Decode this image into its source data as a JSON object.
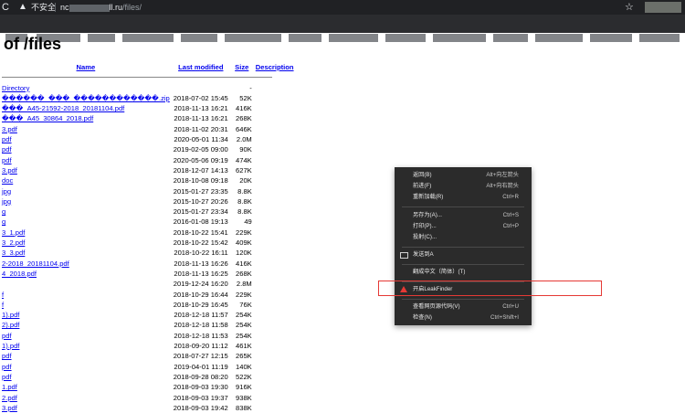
{
  "browser": {
    "reload_glyph": "C",
    "warning_glyph": "▲",
    "insecure_label": "不安全",
    "url_prefix": "nc",
    "url_suffix": "ll.ru",
    "url_path": "/files/",
    "star_glyph": "☆"
  },
  "page": {
    "title": "of /files",
    "columns": [
      "Name",
      "Last modified",
      "Size",
      "Description"
    ],
    "parent_label": "Directory",
    "parent_size": "-",
    "rows": [
      {
        "name": "������_���_������������.zip",
        "modified": "2018-07-02 15:45",
        "size": "52K"
      },
      {
        "name": "���_A45-21592-2018_20181104.pdf",
        "modified": "2018-11-13 16:21",
        "size": "416K"
      },
      {
        "name": "���_A45_30864_2018.pdf",
        "modified": "2018-11-13 16:21",
        "size": "268K"
      },
      {
        "name": "3.pdf",
        "modified": "2018-11-02 20:31",
        "size": "646K"
      },
      {
        "name": "pdf",
        "modified": "2020-05-01 11:34",
        "size": "2.0M"
      },
      {
        "name": "pdf",
        "modified": "2019-02-05 09:00",
        "size": "90K"
      },
      {
        "name": "pdf",
        "modified": "2020-05-06 09:19",
        "size": "474K"
      },
      {
        "name": "3.pdf",
        "modified": "2018-12-07 14:13",
        "size": "627K"
      },
      {
        "name": "doc",
        "modified": "2018-10-08 09:18",
        "size": "20K"
      },
      {
        "name": "jpg",
        "modified": "2015-01-27 23:35",
        "size": "8.8K"
      },
      {
        "name": "jpg",
        "modified": "2015-10-27 20:26",
        "size": "8.8K"
      },
      {
        "name": "g",
        "modified": "2015-01-27 23:34",
        "size": "8.8K"
      },
      {
        "name": "g",
        "modified": "2016-01-08 19:13",
        "size": "49"
      },
      {
        "name": "3_1.pdf",
        "modified": "2018-10-22 15:41",
        "size": "229K"
      },
      {
        "name": "3_2.pdf",
        "modified": "2018-10-22 15:42",
        "size": "409K"
      },
      {
        "name": "3_3.pdf",
        "modified": "2018-10-22 16:11",
        "size": "120K"
      },
      {
        "name": "2-2018_20181104.pdf",
        "modified": "2018-11-13 16:26",
        "size": "416K"
      },
      {
        "name": "4_2018.pdf",
        "modified": "2018-11-13 16:25",
        "size": "268K"
      },
      {
        "name": "",
        "modified": "2019-12-24 16:20",
        "size": "2.8M"
      },
      {
        "name": "f",
        "modified": "2018-10-29 16:44",
        "size": "229K"
      },
      {
        "name": "f",
        "modified": "2018-10-29 16:45",
        "size": "76K"
      },
      {
        "name": "1).pdf",
        "modified": "2018-12-18 11:57",
        "size": "254K"
      },
      {
        "name": "2).pdf",
        "modified": "2018-12-18 11:58",
        "size": "254K"
      },
      {
        "name": "pdf",
        "modified": "2018-12-18 11:53",
        "size": "254K"
      },
      {
        "name": "1).pdf",
        "modified": "2018-09-20 11:12",
        "size": "461K"
      },
      {
        "name": "pdf",
        "modified": "2018-07-27 12:15",
        "size": "265K"
      },
      {
        "name": "pdf",
        "modified": "2019-04-01 11:19",
        "size": "140K"
      },
      {
        "name": "pdf",
        "modified": "2018-09-28 08:20",
        "size": "522K"
      },
      {
        "name": "1.pdf",
        "modified": "2018-09-03 19:30",
        "size": "916K"
      },
      {
        "name": "2.pdf",
        "modified": "2018-09-03 19:37",
        "size": "938K"
      },
      {
        "name": "3.pdf",
        "modified": "2018-09-03 19:42",
        "size": "838K"
      }
    ]
  },
  "context_menu": {
    "items": [
      {
        "label": "返回(B)",
        "key": "Alt+向左箭头"
      },
      {
        "label": "前进(F)",
        "key": "Alt+向右箭头"
      },
      {
        "label": "重新加载(R)",
        "key": "Ctrl+R"
      },
      {
        "label": "另存为(A)...",
        "key": "Ctrl+S"
      },
      {
        "label": "打印(P)...",
        "key": "Ctrl+P"
      },
      {
        "label": "投射(C)...",
        "key": ""
      },
      {
        "label": "发送到A",
        "key": ""
      },
      {
        "label": "翻成中文（简体）(T)",
        "key": ""
      },
      {
        "label": "开启LeakFinder",
        "key": ""
      },
      {
        "label": "查看网页源代码(V)",
        "key": "Ctrl+U"
      },
      {
        "label": "检查(N)",
        "key": "Ctrl+Shift+I"
      }
    ]
  },
  "colors": {
    "link": "#0000ee",
    "menu_bg": "#2b2b2b",
    "highlight_border": "#e53935"
  }
}
